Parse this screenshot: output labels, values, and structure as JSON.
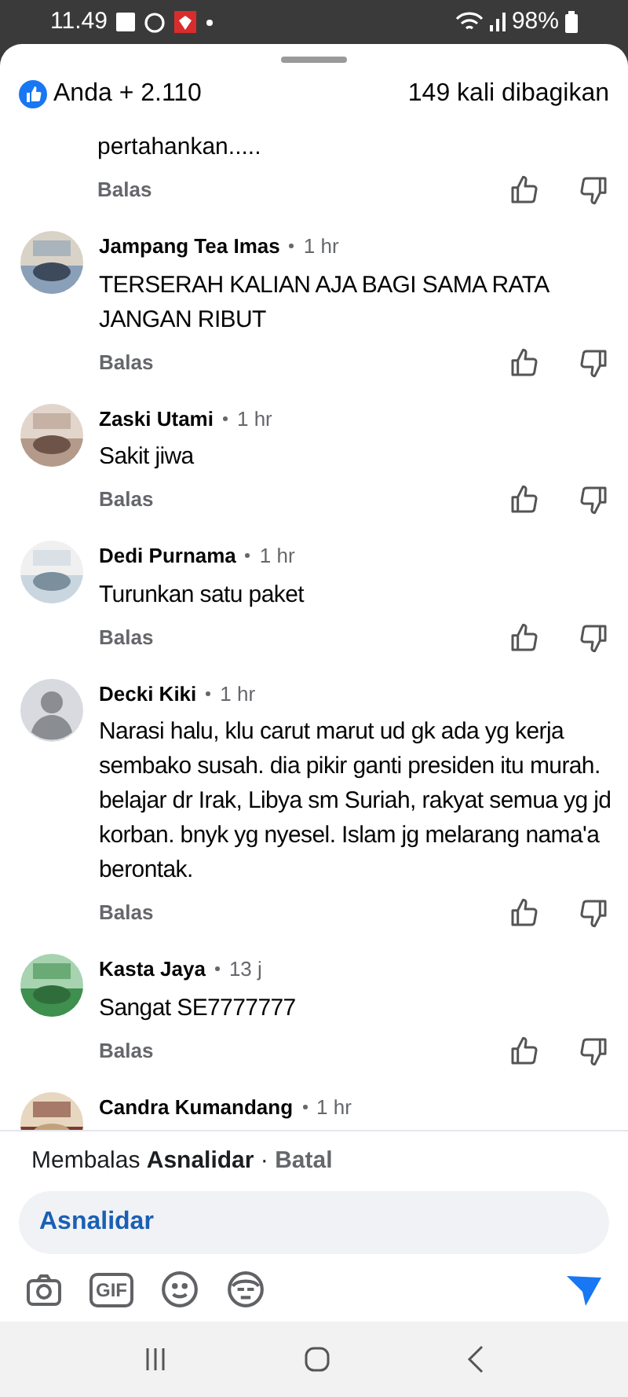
{
  "status_bar": {
    "time": "11.49",
    "battery": "98%"
  },
  "header": {
    "reactions": "Anda + 2.110",
    "shares": "149 kali dibagikan"
  },
  "partial_comment": {
    "text": "pertahankan.....",
    "reply": "Balas"
  },
  "comments": [
    {
      "name": "Jampang Tea Imas",
      "time": "1 hr",
      "text": "TERSERAH KALIAN AJA BAGI SAMA RATA JANGAN RIBUT",
      "reply": "Balas"
    },
    {
      "name": "Zaski Utami",
      "time": "1 hr",
      "text": "Sakit jiwa",
      "reply": "Balas"
    },
    {
      "name": "Dedi Purnama",
      "time": "1 hr",
      "text": "Turunkan satu paket",
      "reply": "Balas"
    },
    {
      "name": "Decki Kiki",
      "time": "1 hr",
      "text": "Narasi halu, klu carut marut ud gk ada yg kerja sembako susah. dia pikir ganti presiden itu murah. belajar dr Irak, Libya sm Suriah, rakyat semua yg jd korban. bnyk yg nyesel. Islam jg melarang nama'a berontak.",
      "reply": "Balas",
      "avatar": {
        "kind": "default"
      }
    },
    {
      "name": "Kasta Jaya",
      "time": "13 j",
      "text": "Sangat SE7777777",
      "reply": "Balas"
    },
    {
      "name": "Candra Kumandang",
      "time": "1 hr"
    }
  ],
  "reply_bar": {
    "replying": "Membalas **Asnalidar** · ",
    "cancel": "Batal",
    "input_value": "Asnalidar",
    "gif": "GIF"
  }
}
